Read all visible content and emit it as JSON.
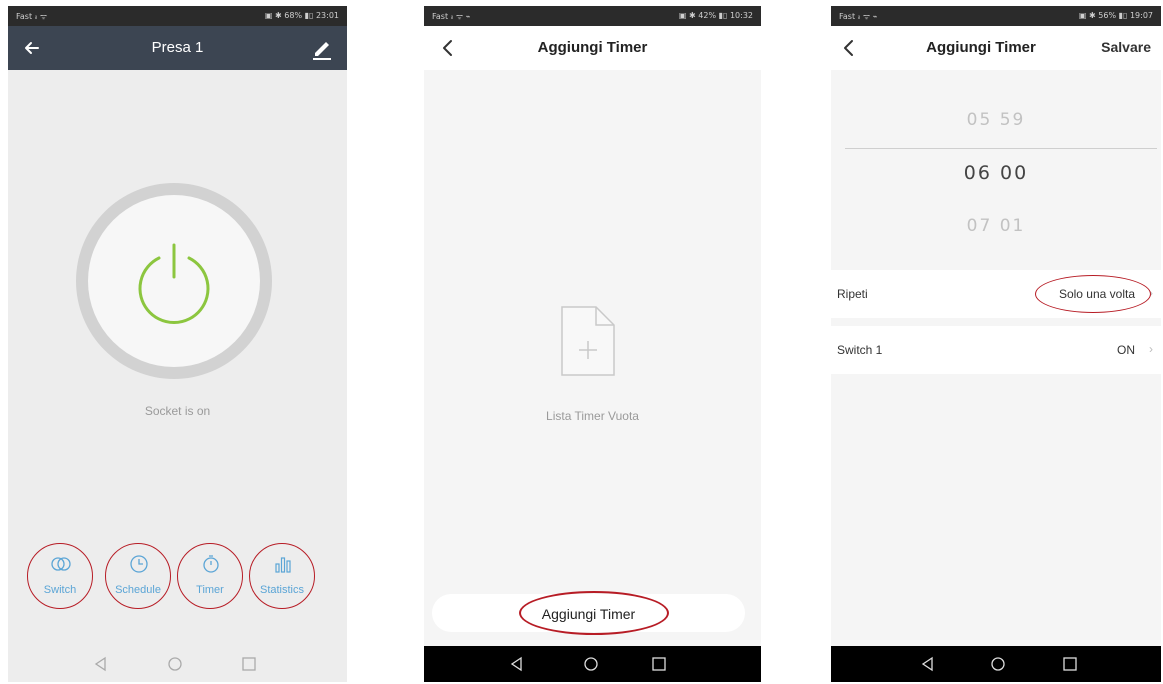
{
  "screens": [
    {
      "status": {
        "left": "Fast ᵢₗ ᯤ",
        "right": "▣ ✱ 68% ▮▯ 23:01"
      },
      "header": {
        "title": "Presa 1"
      },
      "device": {
        "state_text": "Socket is on",
        "accent": "#8cc63f"
      },
      "tabs": [
        {
          "label": "Switch",
          "icon": "toggle-icon"
        },
        {
          "label": "Schedule",
          "icon": "clock-icon"
        },
        {
          "label": "Timer",
          "icon": "stopwatch-icon"
        },
        {
          "label": "Statistics",
          "icon": "bar-chart-icon"
        }
      ]
    },
    {
      "status": {
        "left": "Fast ᵢₗ ᯤ ⌁",
        "right": "▣ ✱ 42% ▮▯ 10:32"
      },
      "header": {
        "title": "Aggiungi Timer"
      },
      "empty": {
        "text": "Lista Timer Vuota",
        "icon": "empty-document-icon"
      },
      "action": {
        "label": "Aggiungi Timer"
      }
    },
    {
      "status": {
        "left": "Fast ᵢₗ ᯤ ⌁",
        "right": "▣ ✱ 56% ▮▯ 19:07"
      },
      "header": {
        "title": "Aggiungi Timer",
        "save_label": "Salvare"
      },
      "picker": [
        {
          "hour": "05",
          "minute": "59"
        },
        {
          "hour": "06",
          "minute": "00"
        },
        {
          "hour": "07",
          "minute": "01"
        }
      ],
      "settings": [
        {
          "label": "Ripeti",
          "value": "Solo una volta"
        },
        {
          "label": "Switch 1",
          "value": "ON"
        }
      ]
    }
  ],
  "colors": {
    "annotation": "#b71c25",
    "tab_label": "#5ba5d6",
    "header_bg": "#3c4552"
  }
}
